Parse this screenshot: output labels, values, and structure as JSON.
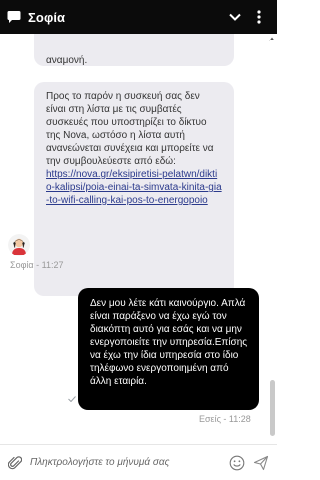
{
  "header": {
    "title": "Σοφία",
    "icons": [
      "chat-bubble-icon",
      "chevron-down-icon",
      "more-vertical-icon"
    ]
  },
  "messages": [
    {
      "direction": "incoming",
      "text": "αναμονή."
    },
    {
      "direction": "incoming",
      "text": "Προς το παρόν η συσκευή σας δεν είναι στη λίστα με τις συμβατές συσκευές που υποστηρίζει το δίκτυο της Nova, ωστόσο η λίστα αυτή ανανεώνεται συνέχεια και μπορείτε να την συμβουλεύεστε από εδώ:",
      "link": "https://nova.gr/eksipiretisi-pelatwn/diktio-kalipsi/poia-einai-ta-simvata-kinita-gia-to-wifi-calling-kai-pos-to-energopoio",
      "meta": "Σοφία - 11:27"
    },
    {
      "direction": "outgoing",
      "text": "Δεν μου λέτε κάτι καινούργιο. Απλά είναι παράξενο να έχω εγώ τον διακόπτη αυτό για εσάς και να μην ενεργοποιείτε την υπηρεσία.Επίσης να έχω την ίδια υπηρεσία στο ίδιο τηλέφωνο ενεργοποιημένη από άλλη εταιρία.",
      "meta": "Εσείς - 11:28"
    }
  ],
  "composer": {
    "placeholder": "Πληκτρολογήστε το μήνυμά σας",
    "icons": [
      "paperclip-icon",
      "emoji-icon",
      "send-icon"
    ]
  }
}
